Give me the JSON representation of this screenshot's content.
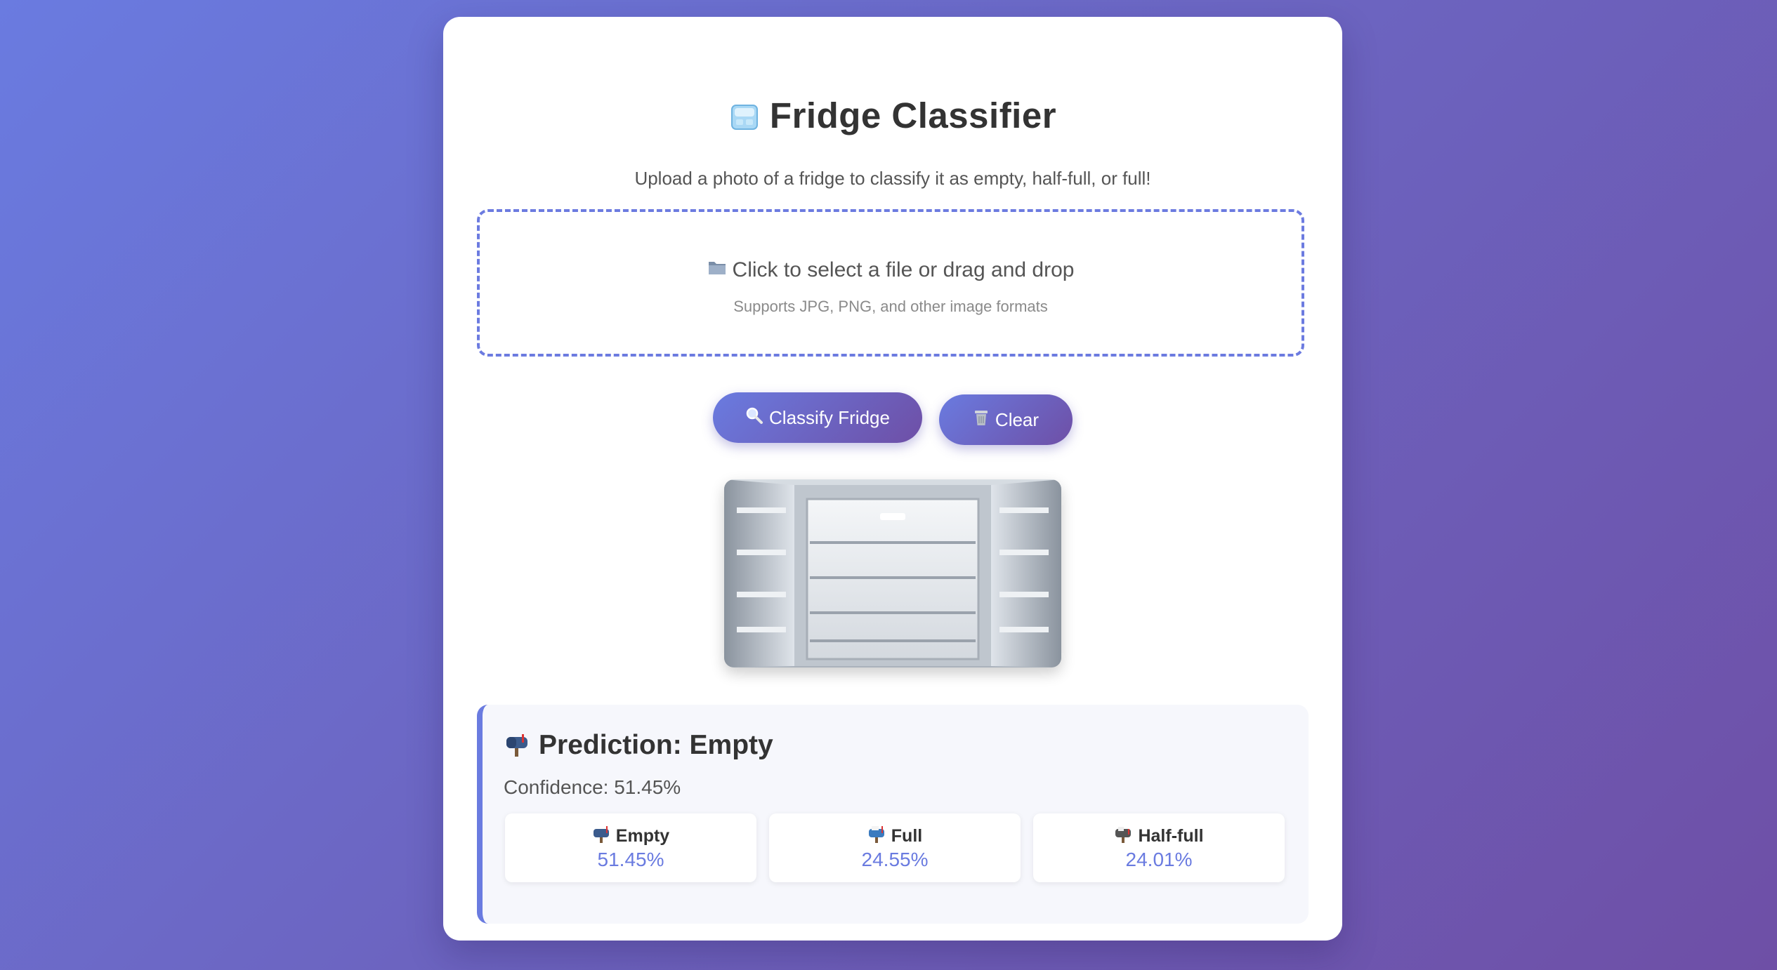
{
  "app": {
    "title": "Fridge Classifier",
    "title_icon": "ice-cube-icon",
    "subtitle": "Upload a photo of a fridge to classify it as empty, half-full, or full!"
  },
  "dropzone": {
    "icon": "folder-icon",
    "main_text": "Click to select a file or drag and drop",
    "sub_text": "Supports JPG, PNG, and other image formats"
  },
  "buttons": {
    "classify": {
      "label": "Classify Fridge",
      "icon": "magnifier-icon"
    },
    "clear": {
      "label": "Clear",
      "icon": "trash-icon"
    }
  },
  "preview": {
    "image": "open-empty-refrigerator"
  },
  "result": {
    "prediction_label": "Prediction: Empty",
    "prediction_icon": "mailbox-icon",
    "confidence_text": "Confidence: 51.45%",
    "classes": [
      {
        "label": "Empty",
        "value": "51.45%",
        "icon": "mailbox-empty-icon"
      },
      {
        "label": "Full",
        "value": "24.55%",
        "icon": "mailbox-full-icon"
      },
      {
        "label": "Half-full",
        "value": "24.01%",
        "icon": "mailbox-half-icon"
      }
    ]
  },
  "colors": {
    "accent": "#6a7be0",
    "accent_dark": "#6e4fa6",
    "text": "#333333",
    "muted": "#555555"
  }
}
